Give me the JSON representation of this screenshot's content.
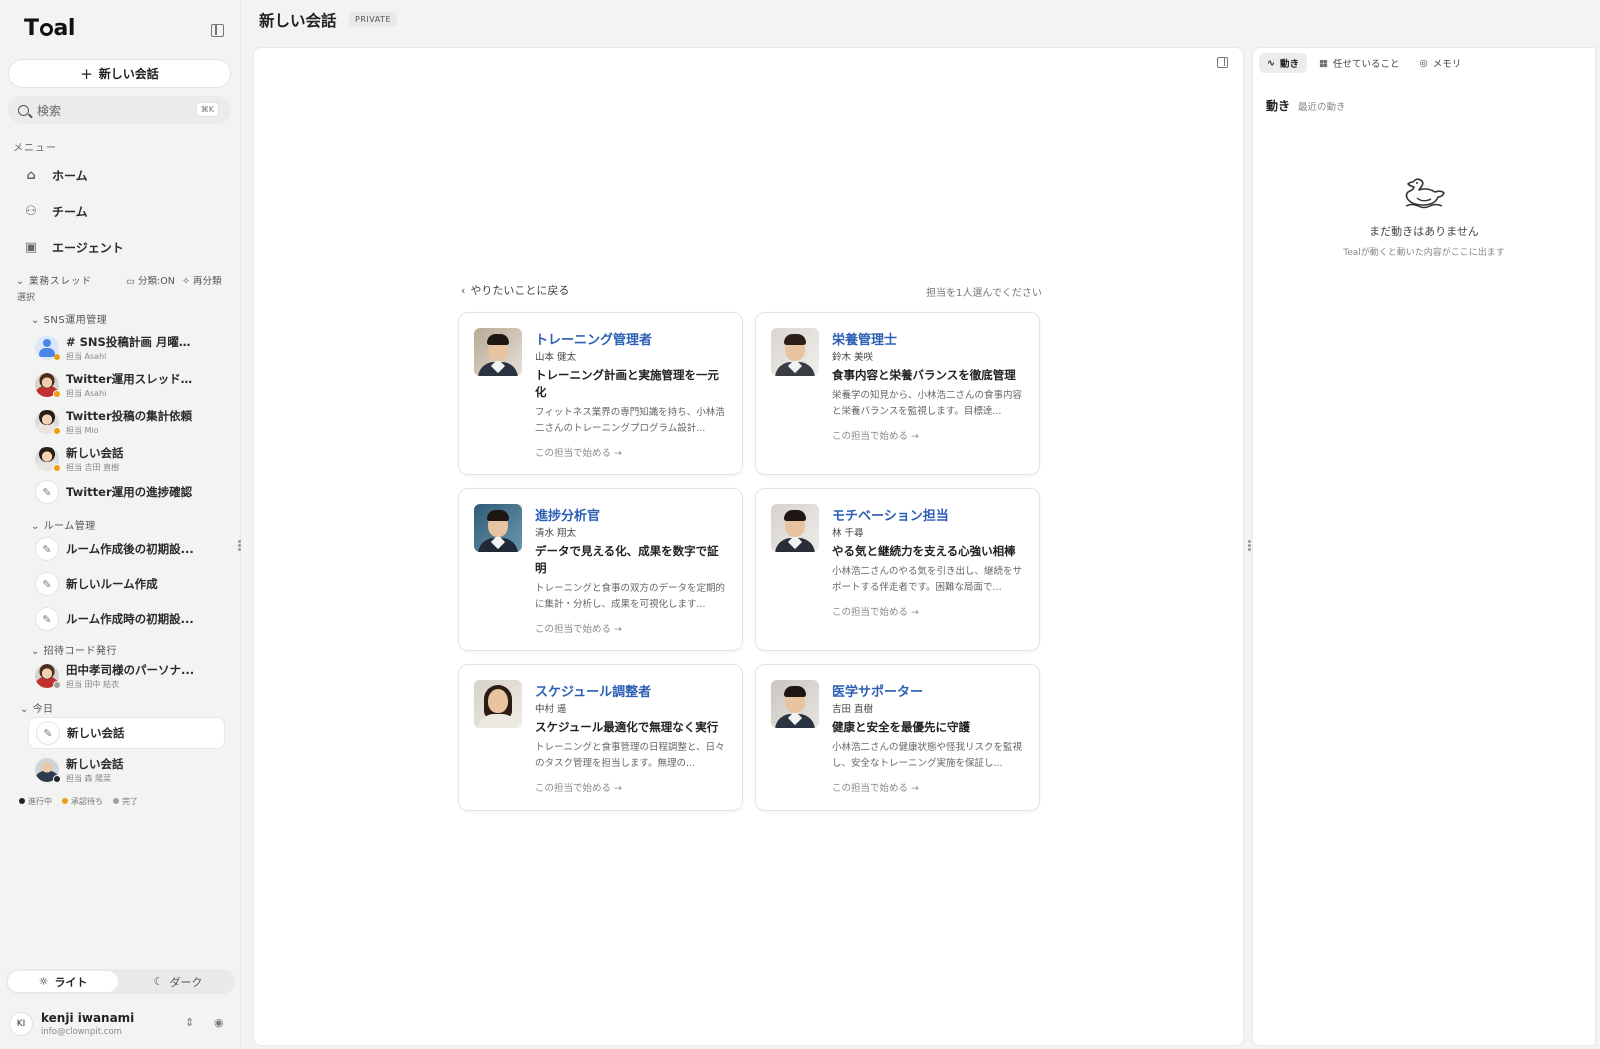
{
  "app": {
    "logo": "Teal"
  },
  "sidebar": {
    "new_chat": "新しい会話",
    "search_placeholder": "検索",
    "search_shortcut": "⌘K",
    "menu_label": "メニュー",
    "nav": [
      {
        "label": "ホーム",
        "icon": "home-icon"
      },
      {
        "label": "チーム",
        "icon": "team-icon"
      },
      {
        "label": "エージェント",
        "icon": "robot-icon"
      }
    ],
    "threads_label": "業務スレッド",
    "classify_label": "分類:ON",
    "reclassify_label": "再分類",
    "select_label": "選択",
    "groups": {
      "sns": {
        "label": "SNS運用管理",
        "items": [
          {
            "title": "# SNS投稿計画 月曜：...",
            "sub": "担当 Asahi",
            "status": "承認待ち"
          },
          {
            "title": "Twitter運用スレッド立...",
            "sub": "担当 Asahi",
            "status": "承認待ち"
          },
          {
            "title": "Twitter投稿の集計依頼",
            "sub": "担当 Mio",
            "status": "承認待ち"
          },
          {
            "title": "新しい会話",
            "sub": "担当 吉田 直樹",
            "status": "承認待ち"
          },
          {
            "title": "Twitter運用の進捗確認",
            "sub": ""
          }
        ]
      },
      "room": {
        "label": "ルーム管理",
        "items": [
          {
            "title": "ルーム作成後の初期設..."
          },
          {
            "title": "新しいルーム作成"
          },
          {
            "title": "ルーム作成時の初期設..."
          }
        ]
      },
      "invite": {
        "label": "招待コード発行",
        "items": [
          {
            "title": "田中孝司様のパーソナ...",
            "sub": "担当 田中 結衣",
            "status": "完了"
          }
        ]
      },
      "today": {
        "label": "今日",
        "items": [
          {
            "title": "新しい会話"
          },
          {
            "title": "新しい会話",
            "sub": "担当 森 陽菜",
            "status": "進行中"
          }
        ]
      }
    },
    "legend": [
      {
        "label": "進行中",
        "color": "#222222"
      },
      {
        "label": "承認待ち",
        "color": "#f39c12"
      },
      {
        "label": "完了",
        "color": "#9e9e9e"
      }
    ],
    "theme": {
      "light": "ライト",
      "dark": "ダーク"
    },
    "user": {
      "initials": "KI",
      "name": "kenji iwanami",
      "email": "info@clownpit.com"
    }
  },
  "header": {
    "title": "新しい会話",
    "badge": "PRIVATE"
  },
  "main": {
    "back_label": "やりたいことに戻る",
    "pick_note": "担当を1人選んでください",
    "cta": "この担当で始める →",
    "cards": [
      {
        "role": "トレーニング管理者",
        "person": "山本 健太",
        "tagline": "トレーニング計画と実施管理を一元化",
        "desc": "フィットネス業界の専門知識を持ち、小林浩二さんのトレーニングプログラム設計..."
      },
      {
        "role": "栄養管理士",
        "person": "鈴木 美咲",
        "tagline": "食事内容と栄養バランスを徹底管理",
        "desc": "栄養学の知見から、小林浩二さんの食事内容と栄養バランスを監視します。目標達..."
      },
      {
        "role": "進捗分析官",
        "person": "清水 翔太",
        "tagline": "データで見える化、成果を数字で証明",
        "desc": "トレーニングと食事の双方のデータを定期的に集計・分析し、成果を可視化します..."
      },
      {
        "role": "モチベーション担当",
        "person": "林 千尋",
        "tagline": "やる気と継続力を支える心強い相棒",
        "desc": "小林浩二さんのやる気を引き出し、継続をサポートする伴走者です。困難な局面で..."
      },
      {
        "role": "スケジュール調整者",
        "person": "中村 遥",
        "tagline": "スケジュール最適化で無理なく実行",
        "desc": "トレーニングと食事管理の日程調整と、日々のタスク管理を担当します。無理の..."
      },
      {
        "role": "医学サポーター",
        "person": "吉田 直樹",
        "tagline": "健康と安全を最優先に守護",
        "desc": "小林浩二さんの健康状態や怪我リスクを監視し、安全なトレーニング実施を保証し..."
      }
    ]
  },
  "right_panel": {
    "tabs": [
      {
        "label": "動き",
        "icon": "activity-icon"
      },
      {
        "label": "任せていること",
        "icon": "calendar-icon"
      },
      {
        "label": "メモリ",
        "icon": "memory-icon"
      }
    ],
    "section_title": "動き",
    "section_sub": "最近の動き",
    "empty_title": "まだ動きはありません",
    "empty_sub": "Tealが動くと動いた内容がここに出ます"
  }
}
